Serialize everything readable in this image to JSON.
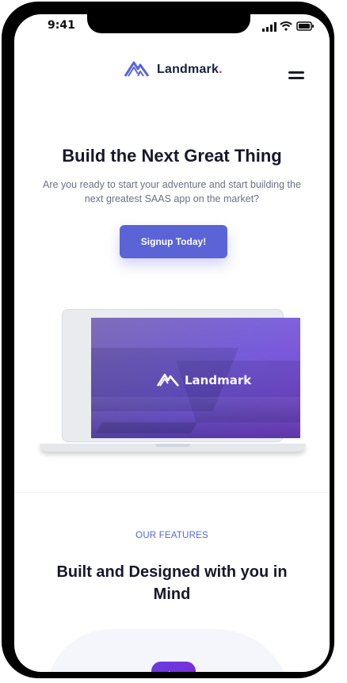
{
  "status_bar": {
    "time": "9:41",
    "icons": [
      "signal-icon",
      "wifi-icon",
      "battery-icon"
    ]
  },
  "header": {
    "brand_name": "Landmark",
    "brand_dot": ".",
    "logo_icon": "landmark-mountain-logo-icon",
    "menu_icon": "hamburger-menu-icon"
  },
  "hero": {
    "title": "Build the Next Great Thing",
    "subtitle": "Are you ready to start your adventure and start building the next greatest SAAS app on the market?",
    "cta_label": "Signup Today!"
  },
  "showcase": {
    "screen_brand": "Landmark"
  },
  "features": {
    "eyebrow": "OUR FEATURES",
    "title": "Built and Designed with you in Mind",
    "play_icon": "play-icon"
  },
  "colors": {
    "accent": "#5a64d6",
    "brand_dot": "#e6336f",
    "heading": "#16182a",
    "body_text": "#6b7184",
    "play_gradient": "#7d2bd6"
  }
}
